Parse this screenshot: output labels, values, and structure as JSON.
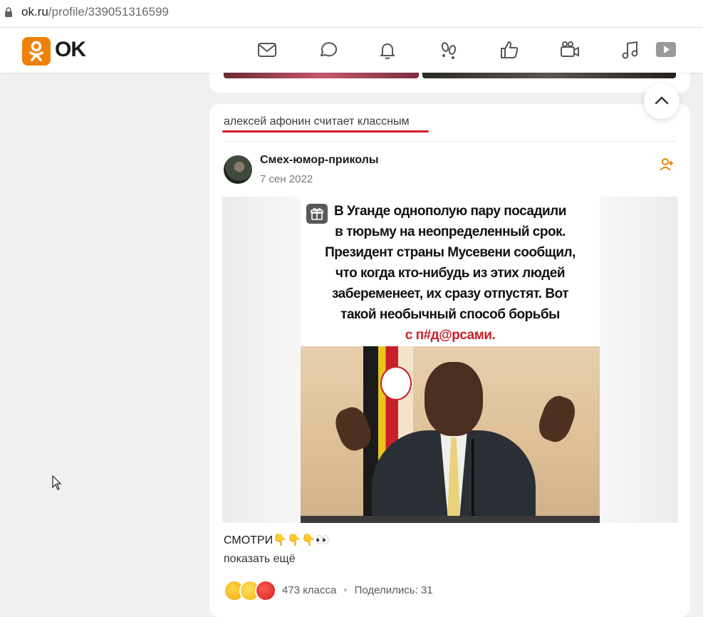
{
  "browser": {
    "url_domain": "ok.ru",
    "url_path": "/profile/339051316599"
  },
  "header": {
    "logo_text": "OK",
    "brand_color": "#ee8208",
    "nav_icons": [
      "mail-icon",
      "discussions-icon",
      "notifications-icon",
      "guests-icon",
      "likes-icon",
      "video-icon",
      "music-icon",
      "video-player-icon"
    ]
  },
  "feed": {
    "liked_by_text": "алексей афонин считает классным",
    "post": {
      "group_name": "Смех-юмор-приколы",
      "date": "7 сен 2022",
      "meme_lines": [
        "В Уганде однополую пару посадили",
        "в тюрьму на неопределенный срок.",
        "Президент страны Мусевени сообщил,",
        "что когда кто-нибудь из этих людей",
        "забеременеет, их сразу отпустят. Вот",
        "такой необычный способ борьбы",
        "с п#д@рсами."
      ],
      "caption": "СМОТРИ👇👇👇👀",
      "show_more": "показать ещё",
      "likes": "473 класса",
      "shares": "Поделились: 31"
    }
  }
}
